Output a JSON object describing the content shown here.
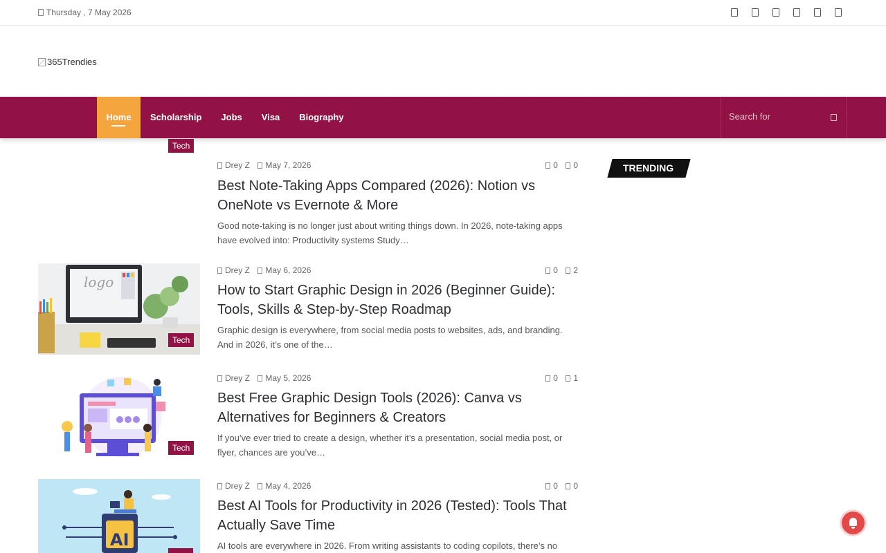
{
  "topbar": {
    "date": "Thursday , 7 May 2026",
    "social_icons": [
      "facebook-icon",
      "twitter-icon",
      "pinterest-icon",
      "linkedin-icon",
      "instagram-icon",
      "rss-icon"
    ]
  },
  "logo": {
    "alt": "365Trendies"
  },
  "nav": {
    "items": [
      {
        "label": "Home",
        "active": true
      },
      {
        "label": "Scholarship"
      },
      {
        "label": "Jobs"
      },
      {
        "label": "Visa"
      },
      {
        "label": "Biography"
      }
    ],
    "search_placeholder": "Search for"
  },
  "first_post_category": "Tech",
  "posts": [
    {
      "author": "Drey Z",
      "date": "May 7, 2026",
      "views": "0",
      "comments": "0",
      "title": "Best Note-Taking Apps Compared (2026): Notion vs OneNote vs Evernote & More",
      "excerpt": "Good note-taking is no longer just about writing things down. In 2026, note-taking apps have evolved into: Productivity systems Study…"
    },
    {
      "author": "Drey Z",
      "date": "May 6, 2026",
      "views": "0",
      "comments": "2",
      "category": "Tech",
      "title": "How to Start Graphic Design in 2026 (Beginner Guide): Tools, Skills & Step-by-Step Roadmap",
      "excerpt": "Graphic design is everywhere, from social media posts to websites, ads, and branding. And in 2026, it’s one of the…"
    },
    {
      "author": "Drey Z",
      "date": "May 5, 2026",
      "views": "0",
      "comments": "1",
      "category": "Tech",
      "title": "Best Free Graphic Design Tools (2026): Canva vs Alternatives for Beginners & Creators",
      "excerpt": "If you’ve ever tried to create a design, whether it’s a presentation, social media post, or flyer, chances are you’ve…"
    },
    {
      "author": "Drey Z",
      "date": "May 4, 2026",
      "views": "0",
      "comments": "0",
      "title": "Best AI Tools for Productivity in 2026 (Tested): Tools That Actually Save Time",
      "excerpt": "AI tools are everywhere in 2026. From writing assistants to coding copilots, there’s no"
    }
  ],
  "sidebar": {
    "trending_label": "TRENDING"
  },
  "colors": {
    "brand": "#921245",
    "accent": "#f4a53d",
    "bell": "#e24a4a"
  }
}
